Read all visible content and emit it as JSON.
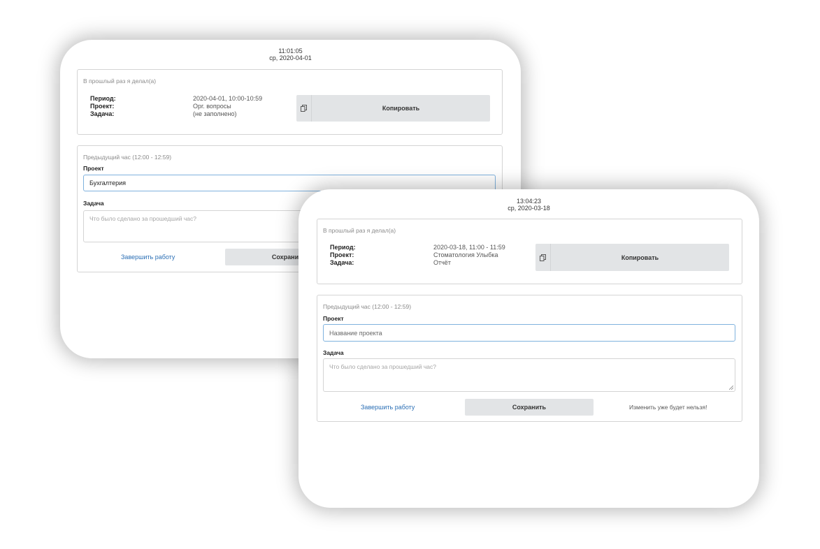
{
  "back_window": {
    "time": "11:01:05",
    "date": "ср, 2020-04-01",
    "last_entry": {
      "caption": "В прошлый раз я делал(а)",
      "labels": {
        "period": "Период:",
        "project": "Проект:",
        "task": "Задача:"
      },
      "values": {
        "period": "2020-04-01, 10:00-10:59",
        "project": "Орг. вопросы",
        "task": "(не заполнено)"
      },
      "copy_label": "Копировать",
      "copy_icon": "copy-icon"
    },
    "form": {
      "caption": "Предыдущий час (12:00 - 12:59)",
      "project_label": "Проект",
      "project_value": "Бухгалтерия",
      "task_label": "Задача",
      "task_placeholder": "Что было сделано за прошедший час?",
      "finish_label": "Завершить работу",
      "save_label": "Сохранить"
    }
  },
  "front_window": {
    "time": "13:04:23",
    "date": "ср, 2020-03-18",
    "last_entry": {
      "caption": "В прошлый раз я делал(а)",
      "labels": {
        "period": "Период:",
        "project": "Проект:",
        "task": "Задача:"
      },
      "values": {
        "period": "2020-03-18, 11:00 - 11:59",
        "project": "Стоматология Улыбка",
        "task": "Отчёт"
      },
      "copy_label": "Копировать",
      "copy_icon": "copy-icon"
    },
    "form": {
      "caption": "Предыдущий час (12:00 - 12:59)",
      "project_label": "Проект",
      "project_placeholder": "Название проекта",
      "task_label": "Задача",
      "task_placeholder": "Что было сделано за прошедший час?",
      "finish_label": "Завершить работу",
      "save_label": "Сохранить",
      "warning": "Изменить уже будет нельзя!"
    }
  },
  "colors": {
    "link": "#2b6fb5",
    "button_bg": "#e2e4e6",
    "input_focus": "#7fb2de"
  }
}
